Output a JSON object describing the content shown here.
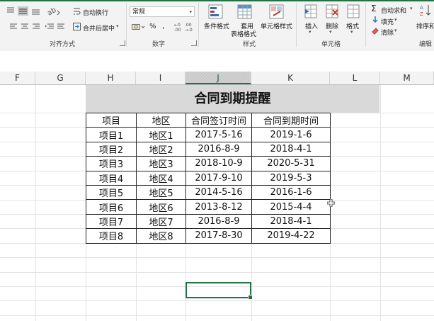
{
  "ribbon": {
    "alignment": {
      "wrap_text": "自动换行",
      "merge_center": "合并后居中",
      "group_label": "对齐方式"
    },
    "number": {
      "format_value": "常规",
      "percent": "%",
      "comma": ",",
      "group_label": "数字"
    },
    "styles": {
      "conditional_format": "条件格式",
      "table_format_line1": "套用",
      "table_format_line2": "表格格式",
      "cell_styles": "单元格样式",
      "group_label": "样式"
    },
    "cells": {
      "insert": "插入",
      "delete": "删除",
      "format": "格式",
      "group_label": "单元格"
    },
    "editing": {
      "autosum": "自动求和",
      "fill": "填充",
      "clear": "清除",
      "sort_filter": "排序和",
      "group_label": "编辑"
    }
  },
  "columns": [
    "F",
    "G",
    "H",
    "I",
    "J",
    "K",
    "L",
    "M"
  ],
  "selected_column": "J",
  "sheet": {
    "title": "合同到期提醒",
    "headers": [
      "项目",
      "地区",
      "合同签订时间",
      "合同到期时间"
    ],
    "rows": [
      [
        "项目1",
        "地区1",
        "2017-5-16",
        "2019-1-6"
      ],
      [
        "项目2",
        "地区2",
        "2016-8-9",
        "2018-4-1"
      ],
      [
        "项目3",
        "地区3",
        "2018-10-9",
        "2020-5-31"
      ],
      [
        "项目4",
        "地区4",
        "2017-9-10",
        "2019-5-3"
      ],
      [
        "项目5",
        "地区5",
        "2014-5-16",
        "2016-1-6"
      ],
      [
        "项目6",
        "地区6",
        "2013-8-12",
        "2015-4-4"
      ],
      [
        "项目7",
        "地区7",
        "2016-8-9",
        "2018-4-1"
      ],
      [
        "项目8",
        "地区8",
        "2017-8-30",
        "2019-4-22"
      ]
    ]
  },
  "colors": {
    "accent": "#217346",
    "title_fill": "#d9d9d9"
  }
}
